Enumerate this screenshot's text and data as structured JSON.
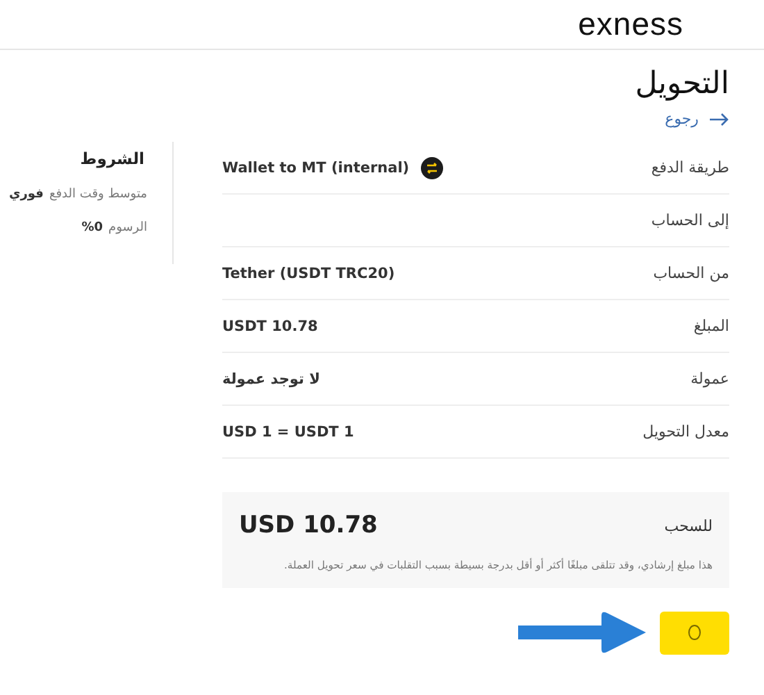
{
  "header": {
    "logo": "exness"
  },
  "page": {
    "title": "التحويل",
    "back_link": "رجوع"
  },
  "details": [
    {
      "label": "طريقة الدفع",
      "value": "Wallet to MT (internal)",
      "kind": "method"
    },
    {
      "label": "إلى الحساب",
      "kind": "plain"
    },
    {
      "label": "من الحساب",
      "value": "Tether (USDT TRC20)",
      "kind": "plain"
    },
    {
      "label": "المبلغ",
      "value": "USDT 10.78",
      "kind": "plain"
    },
    {
      "label": "عمولة",
      "value": "لا توجد عمولة",
      "kind": "plain"
    },
    {
      "label": "معدل التحويل",
      "value": "USD 1 = USDT 1",
      "kind": "plain"
    }
  ],
  "conditions": {
    "title": "الشروط",
    "items": [
      {
        "label": "متوسط وقت الدفع",
        "value": "فوري"
      },
      {
        "label": "الرسوم",
        "value": "%0"
      }
    ]
  },
  "summary": {
    "label": "للسحب",
    "amount": "USD 10.78",
    "note": "هذا مبلغ إرشادي، وقد تتلقى مبلغًا أكثر أو أقل بدرجة بسيطة بسبب التقلبات في سعر تحويل العملة."
  },
  "submit": {
    "loading": true
  }
}
